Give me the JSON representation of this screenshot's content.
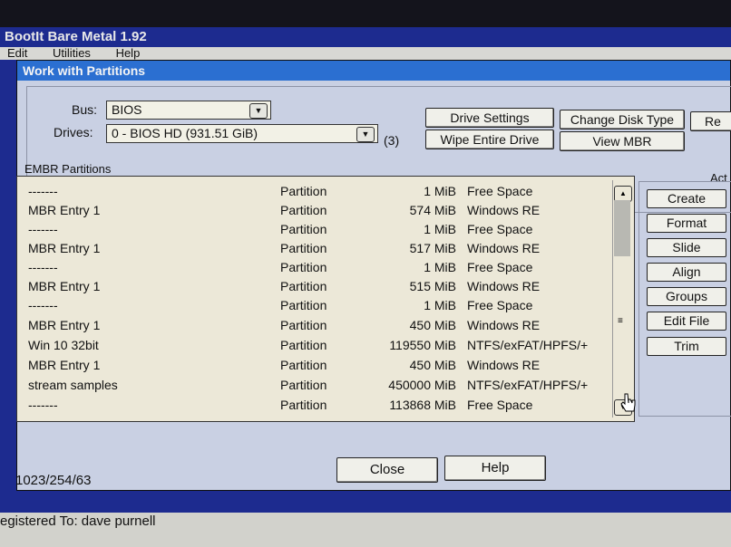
{
  "app": {
    "title": "BootIt Bare Metal 1.92"
  },
  "menu": [
    "Edit",
    "Utilities",
    "Help"
  ],
  "dialog": {
    "title": "Work with Partitions"
  },
  "bus": {
    "label": "Bus:",
    "value": "BIOS"
  },
  "drives": {
    "label": "Drives:",
    "value": "0 - BIOS HD (931.51 GiB)",
    "count": "(3)"
  },
  "top_buttons": {
    "drive_settings": "Drive Settings",
    "change_disk_type": "Change Disk Type",
    "re": "Re",
    "wipe_entire_drive": "Wipe Entire Drive",
    "view_mbr": "View MBR"
  },
  "partitions": {
    "label": "EMBR Partitions",
    "rows": [
      {
        "name": "-------",
        "type": "Partition",
        "size": "1 MiB",
        "fs": "Free Space"
      },
      {
        "name": "MBR Entry 1",
        "type": "Partition",
        "size": "574 MiB",
        "fs": "Windows RE"
      },
      {
        "name": "-------",
        "type": "Partition",
        "size": "1 MiB",
        "fs": "Free Space"
      },
      {
        "name": "MBR Entry 1",
        "type": "Partition",
        "size": "517 MiB",
        "fs": "Windows RE"
      },
      {
        "name": "-------",
        "type": "Partition",
        "size": "1 MiB",
        "fs": "Free Space"
      },
      {
        "name": "MBR Entry 1",
        "type": "Partition",
        "size": "515 MiB",
        "fs": "Windows RE"
      },
      {
        "name": "-------",
        "type": "Partition",
        "size": "1 MiB",
        "fs": "Free Space"
      },
      {
        "name": "MBR Entry 1",
        "type": "Partition",
        "size": "450 MiB",
        "fs": "Windows RE"
      },
      {
        "name": "Win 10 32bit",
        "type": "Partition",
        "size": "119550 MiB",
        "fs": "NTFS/exFAT/HPFS/+"
      },
      {
        "name": "MBR Entry 1",
        "type": "Partition",
        "size": "450 MiB",
        "fs": "Windows RE"
      },
      {
        "name": "stream samples",
        "type": "Partition",
        "size": "450000 MiB",
        "fs": "NTFS/exFAT/HPFS/+"
      },
      {
        "name": "-------",
        "type": "Partition",
        "size": "113868 MiB",
        "fs": "Free Space"
      }
    ]
  },
  "actions": {
    "label": "Act",
    "buttons": [
      "Create",
      "Format",
      "Slide",
      "Align",
      "Groups",
      "Edit File",
      "Trim"
    ]
  },
  "geometry": "1023/254/63",
  "bottom_buttons": {
    "close": "Close",
    "help": "Help"
  },
  "status": {
    "text": "egistered To: dave purnell"
  },
  "colors": {
    "title_bar": "#1d2b8f",
    "dialog_title": "#2b6fd1",
    "dialog_bg": "#c9d0e3",
    "list_bg": "#ece8d8"
  },
  "icons": {
    "dropdown": "chevron-down-icon",
    "scroll_up": "scroll-up-icon",
    "scroll_down": "scroll-down-icon",
    "mouse_cursor": "hand-cursor-icon"
  }
}
